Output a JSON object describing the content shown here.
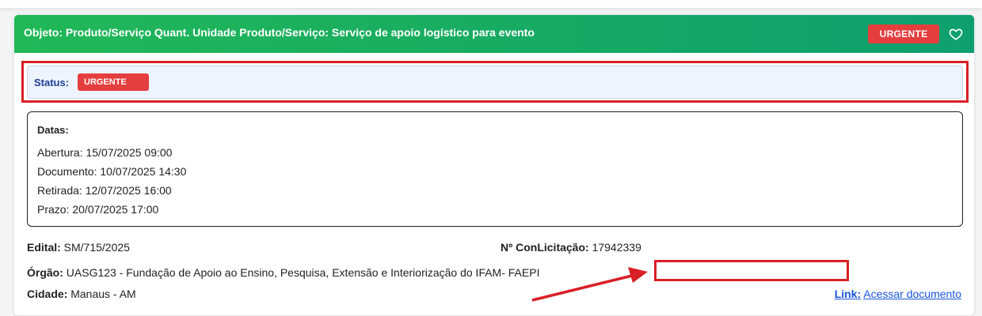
{
  "header": {
    "title": "Objeto: Produto/Serviço Quant. Unidade Produto/Serviço: Serviço de apoio logístico para evento",
    "badge": "URGENTE",
    "favorite_icon": "heart-icon"
  },
  "status": {
    "label": "Status:",
    "badge": "URGENTE"
  },
  "dates": {
    "title": "Datas:",
    "items": [
      "Abertura: 15/07/2025 09:00",
      "Documento: 10/07/2025 14:30",
      "Retirada: 12/07/2025 16:00",
      "Prazo: 20/07/2025 17:00"
    ]
  },
  "info": {
    "edital_label": "Edital:",
    "edital_value": "SM/715/2025",
    "conlicitacao_label": "Nº ConLicitação:",
    "conlicitacao_value": "17942339",
    "orgao_label": "Órgão:",
    "orgao_value": "UASG123 - Fundação de Apoio ao Ensino, Pesquisa, Extensão e Interiorização do IFAM- FAEPI",
    "cidade_label": "Cidade:",
    "cidade_value": "Manaus - AM",
    "link_label": "Link:",
    "link_text": "Acessar documento"
  },
  "colors": {
    "header_start": "#22b857",
    "header_end": "#0e9f6e",
    "urgent": "#e53e3e",
    "annotation": "#d91f26",
    "status_label": "#1d3d91",
    "link": "#1a56db"
  }
}
